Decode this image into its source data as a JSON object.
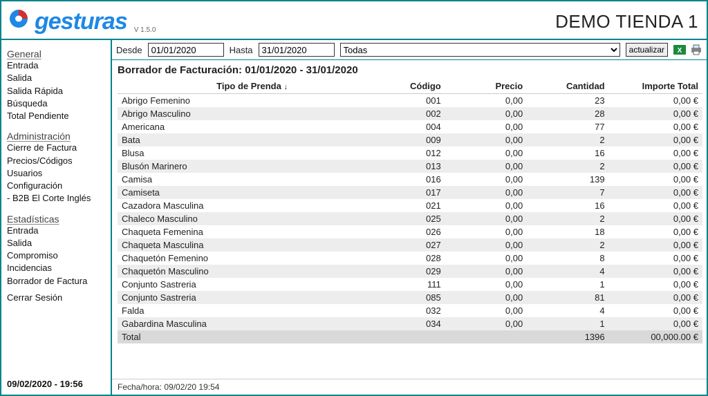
{
  "brand": "gesturas",
  "version": "V 1.5.0",
  "store_name": "DEMO TIENDA 1",
  "sidebar": {
    "groups": [
      {
        "title": "General",
        "items": [
          "Entrada",
          "Salida",
          "Salida Rápida",
          "Búsqueda",
          "Total Pendiente"
        ]
      },
      {
        "title": "Administración",
        "items": [
          "Cierre de Factura",
          "Precios/Códigos",
          "Usuarios",
          "Configuración",
          "- B2B El Corte Inglés"
        ]
      },
      {
        "title": "Estadísticas",
        "items": [
          "Entrada",
          "Salida",
          "Compromiso",
          "Incidencias",
          "Borrador de Factura"
        ]
      }
    ],
    "logout": "Cerrar Sesión",
    "clock": "09/02/2020 - 19:56"
  },
  "filters": {
    "from_label": "Desde",
    "from_value": "01/01/2020",
    "to_label": "Hasta",
    "to_value": "31/01/2020",
    "select_value": "Todas",
    "update_label": "actualizar",
    "export_excel_icon": "excel-icon",
    "print_icon": "print-icon"
  },
  "report": {
    "title": "Borrador de Facturación: 01/01/2020 - 31/01/2020",
    "columns": {
      "tipo": "Tipo de Prenda",
      "sort_indicator": "↓",
      "codigo": "Código",
      "precio": "Precio",
      "cantidad": "Cantidad",
      "importe": "Importe Total"
    },
    "rows": [
      {
        "tipo": "Abrigo Femenino",
        "codigo": "001",
        "precio": "0,00",
        "cantidad": "23",
        "importe": "0,00 €"
      },
      {
        "tipo": "Abrigo Masculino",
        "codigo": "002",
        "precio": "0,00",
        "cantidad": "28",
        "importe": "0,00 €"
      },
      {
        "tipo": "Americana",
        "codigo": "004",
        "precio": "0,00",
        "cantidad": "77",
        "importe": "0,00 €"
      },
      {
        "tipo": "Bata",
        "codigo": "009",
        "precio": "0,00",
        "cantidad": "2",
        "importe": "0,00 €"
      },
      {
        "tipo": "Blusa",
        "codigo": "012",
        "precio": "0,00",
        "cantidad": "16",
        "importe": "0,00 €"
      },
      {
        "tipo": "Blusón Marinero",
        "codigo": "013",
        "precio": "0,00",
        "cantidad": "2",
        "importe": "0,00 €"
      },
      {
        "tipo": "Camisa",
        "codigo": "016",
        "precio": "0,00",
        "cantidad": "139",
        "importe": "0,00 €"
      },
      {
        "tipo": "Camiseta",
        "codigo": "017",
        "precio": "0,00",
        "cantidad": "7",
        "importe": "0,00 €"
      },
      {
        "tipo": "Cazadora Masculina",
        "codigo": "021",
        "precio": "0,00",
        "cantidad": "16",
        "importe": "0,00 €"
      },
      {
        "tipo": "Chaleco Masculino",
        "codigo": "025",
        "precio": "0,00",
        "cantidad": "2",
        "importe": "0,00 €"
      },
      {
        "tipo": "Chaqueta Femenina",
        "codigo": "026",
        "precio": "0,00",
        "cantidad": "18",
        "importe": "0,00 €"
      },
      {
        "tipo": "Chaqueta Masculina",
        "codigo": "027",
        "precio": "0,00",
        "cantidad": "2",
        "importe": "0,00 €"
      },
      {
        "tipo": "Chaquetón Femenino",
        "codigo": "028",
        "precio": "0,00",
        "cantidad": "8",
        "importe": "0,00 €"
      },
      {
        "tipo": "Chaquetón Masculino",
        "codigo": "029",
        "precio": "0,00",
        "cantidad": "4",
        "importe": "0,00 €"
      },
      {
        "tipo": "Conjunto Sastreria",
        "codigo": "111",
        "precio": "0,00",
        "cantidad": "1",
        "importe": "0,00 €"
      },
      {
        "tipo": "Conjunto Sastreria",
        "codigo": "085",
        "precio": "0,00",
        "cantidad": "81",
        "importe": "0,00 €"
      },
      {
        "tipo": "Falda",
        "codigo": "032",
        "precio": "0,00",
        "cantidad": "4",
        "importe": "0,00 €"
      },
      {
        "tipo": "Gabardina Masculina",
        "codigo": "034",
        "precio": "0,00",
        "cantidad": "1",
        "importe": "0,00 €"
      }
    ],
    "totals": {
      "label": "Total",
      "cantidad": "1396",
      "importe": "00,000.00 €"
    }
  },
  "footer_note": "Fecha/hora: 09/02/20 19:54"
}
